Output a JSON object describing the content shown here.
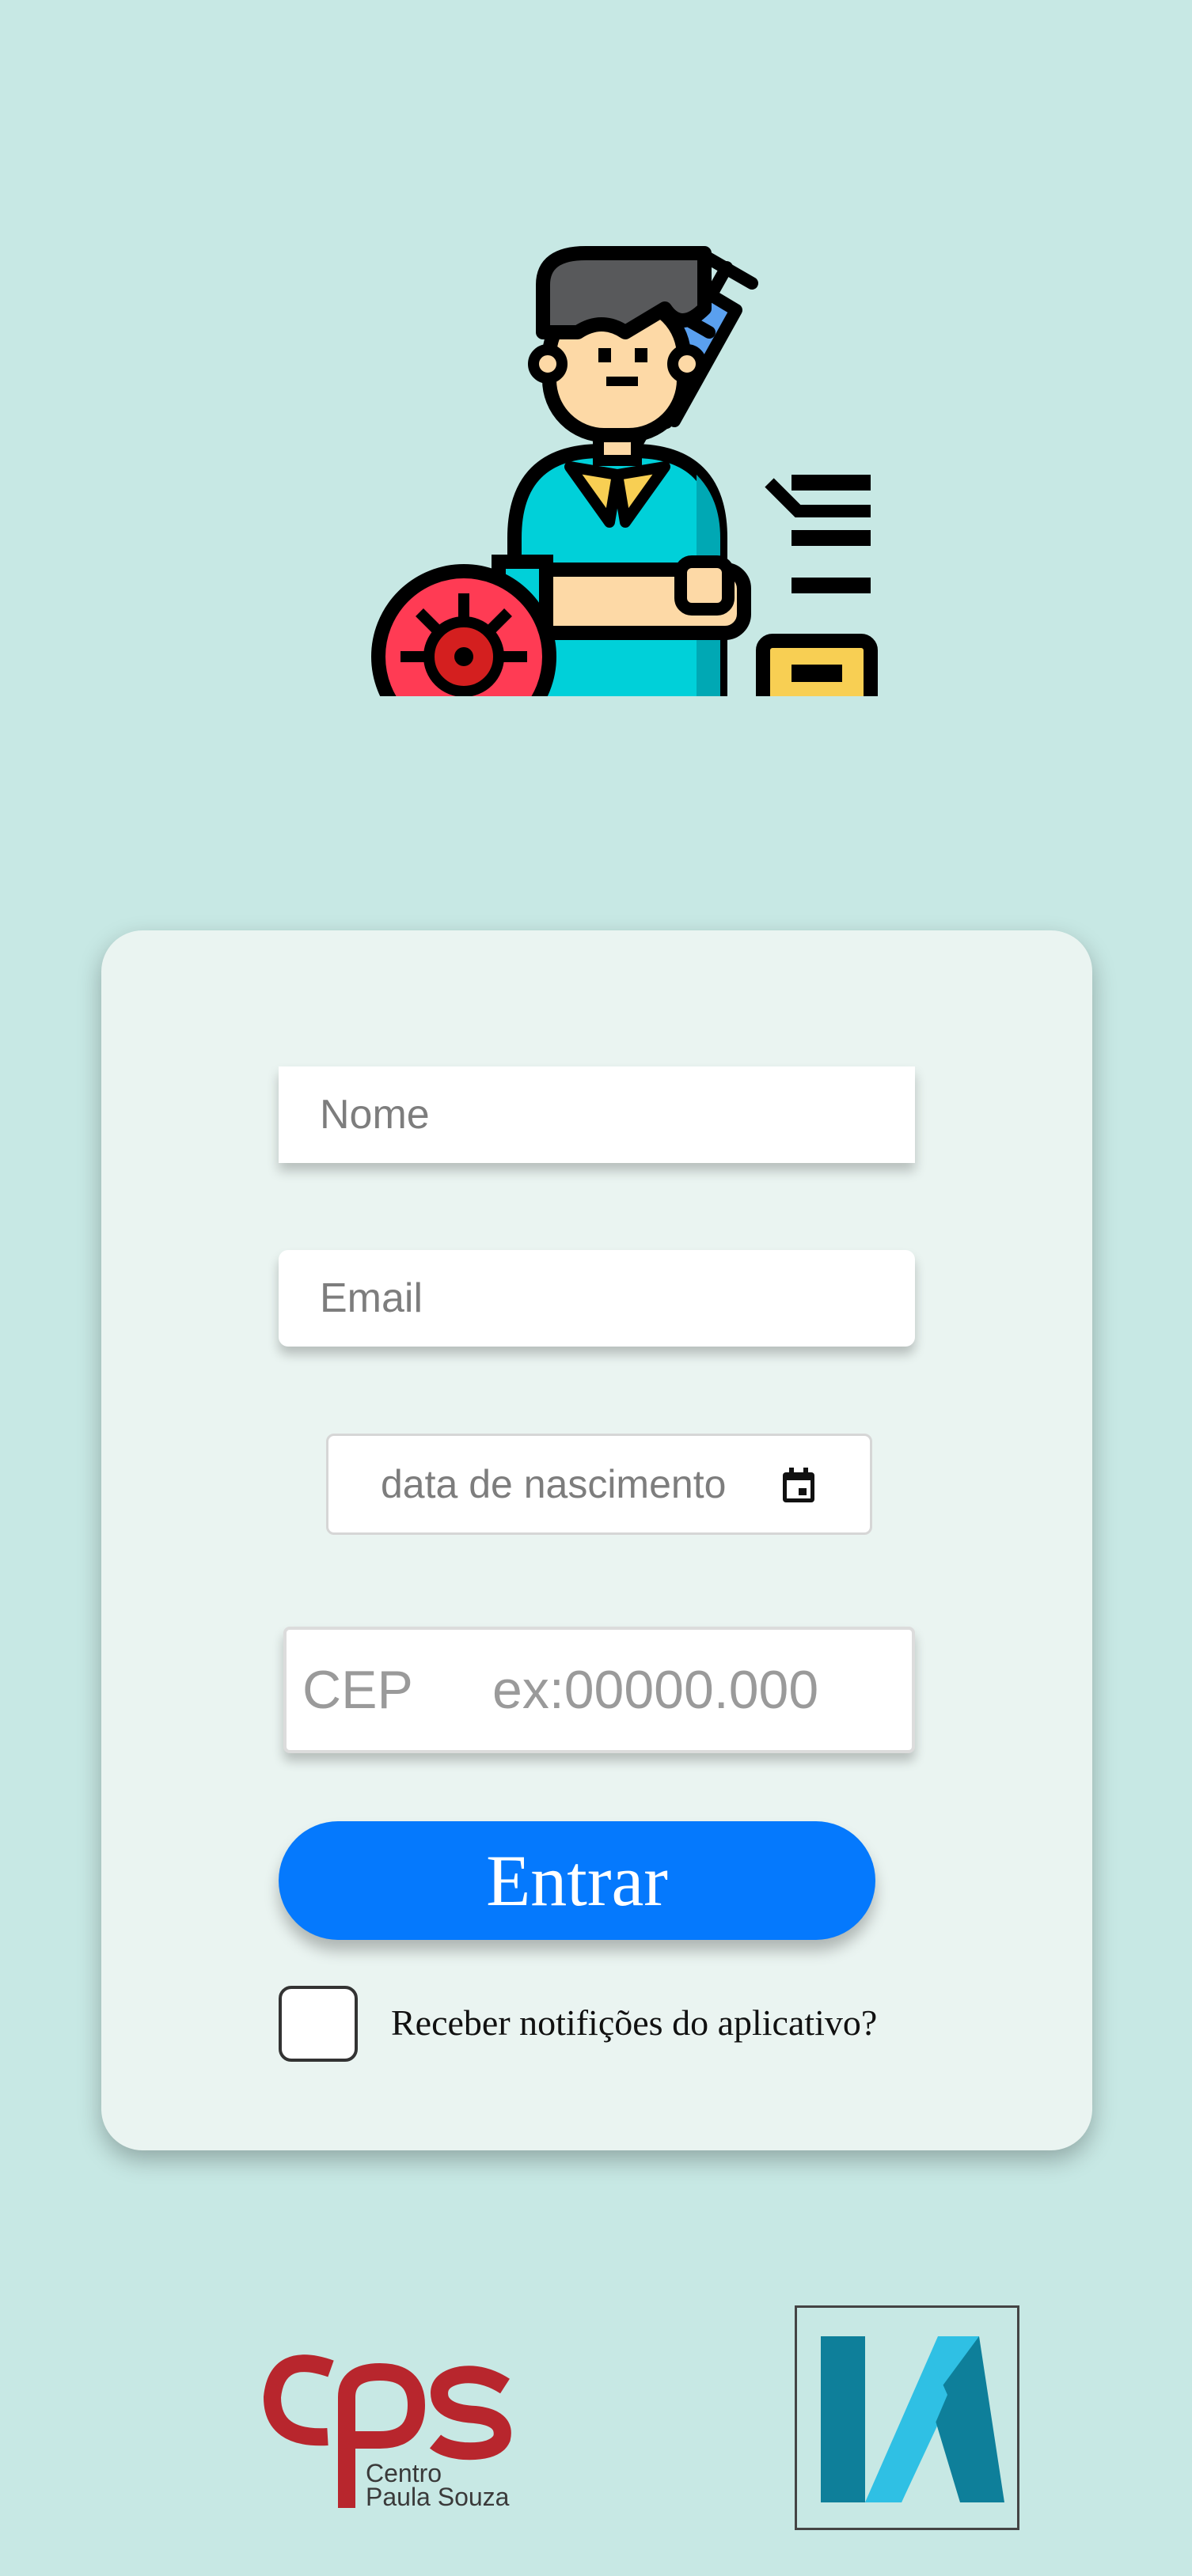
{
  "form": {
    "nome_placeholder": "Nome",
    "email_placeholder": "Email",
    "birthdate_placeholder": "data de nascimento",
    "cep_label": "CEP",
    "cep_placeholder": "ex:00000.000",
    "submit_label": "Entrar",
    "notifications_label": "Receber notifições do aplicativo?",
    "notifications_checked": false
  },
  "logos": {
    "cps_line1": "Centro",
    "cps_line2": "Paula Souza"
  },
  "icons": {
    "hero": "doctor-vaccine-illustration",
    "date": "calendar-icon"
  },
  "colors": {
    "background": "#c7e8e4",
    "card": "#eaf4f1",
    "button": "#0579fd",
    "cps_red": "#b8262d",
    "k_teal": "#0e7f9a",
    "k_light": "#2fc0e4"
  }
}
